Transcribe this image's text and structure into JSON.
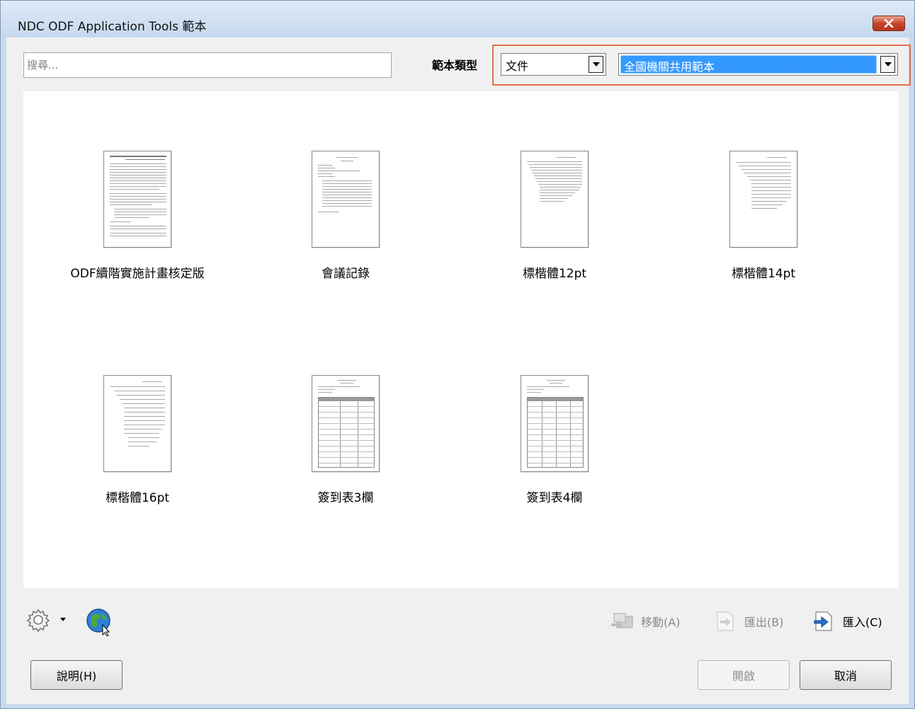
{
  "window": {
    "title": "NDC ODF Application Tools 範本",
    "close_label": "✕"
  },
  "toolbar": {
    "search_placeholder": "搜尋...",
    "type_label": "範本類型",
    "type_value": "文件",
    "category_value": "全國機關共用範本"
  },
  "templates": [
    {
      "name": "ODF續階實施計畫核定版"
    },
    {
      "name": "會議記錄"
    },
    {
      "name": "標楷體12pt"
    },
    {
      "name": "標楷體14pt"
    },
    {
      "name": "標楷體16pt"
    },
    {
      "name": "簽到表3欄"
    },
    {
      "name": "簽到表4欄"
    }
  ],
  "actions": {
    "move": "移動(A)",
    "export": "匯出(B)",
    "import": "匯入(C)"
  },
  "buttons": {
    "help": "說明(H)",
    "open": "開啟",
    "cancel": "取消"
  },
  "colors": {
    "highlight": "#e0704a",
    "selection": "#3399ff",
    "close_button": "#c7452e"
  }
}
